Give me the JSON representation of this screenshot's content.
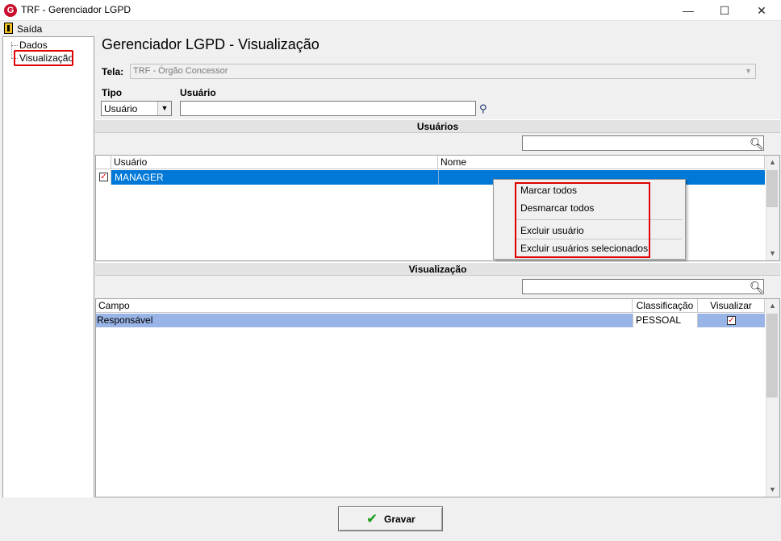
{
  "window": {
    "title": "TRF - Gerenciador LGPD",
    "app_icon_letter": "G",
    "minimize_glyph": "—",
    "maximize_glyph": "☐",
    "close_glyph": "✕"
  },
  "menu": {
    "exit_label": "Saída",
    "exit_icon": "exit-door-icon"
  },
  "tree": {
    "items": [
      "Dados",
      "Visualização"
    ],
    "selected": "Visualização"
  },
  "main": {
    "title": "Gerenciador LGPD - Visualização",
    "tela_label": "Tela:",
    "tela_value": "TRF - Órgão Concessor",
    "tipo_label": "Tipo",
    "tipo_value": "Usuário",
    "usuario_label": "Usuário",
    "usuario_value": ""
  },
  "usuarios": {
    "section_title": "Usuários",
    "columns": [
      "Usuário",
      "Nome"
    ],
    "rows": [
      {
        "checked": true,
        "usuario": "MANAGER",
        "nome": ""
      }
    ]
  },
  "context_menu": {
    "items": [
      "Marcar todos",
      "Desmarcar todos",
      "Excluir usuário",
      "Excluir usuários selecionados"
    ]
  },
  "visualizacao": {
    "section_title": "Visualização",
    "columns": [
      "Campo",
      "Classificação",
      "Visualizar"
    ],
    "rows": [
      {
        "campo": "Responsável",
        "classificacao": "PESSOAL",
        "visualizar": true
      }
    ]
  },
  "footer": {
    "save_label": "Gravar"
  },
  "colors": {
    "selection": "#0078d7",
    "row_highlight": "#99b4e6",
    "annotation_red": "#e00000"
  }
}
